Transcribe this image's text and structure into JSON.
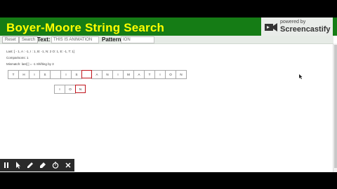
{
  "title": "Boyer-Moore String Search",
  "logo": {
    "small": "powered by",
    "big": "Screencastify"
  },
  "toolbar": {
    "reset_label": "Reset",
    "search_label": "Search",
    "text_label": "Text:",
    "text_value": "THIS IS ANIMATION",
    "pattern_label": "Pattern:",
    "pattern_value": "ION"
  },
  "info": {
    "last_line": "Last: [ - 1, A : -1, I : 1, B: -1, N: 2 O: 1, E: -1, T: 1]",
    "comparisons": "Comparisons: 1",
    "mismatch": "Mismatch: last[ ] = -1   Shifting by 3"
  },
  "text_cells": [
    "T",
    "H",
    "I",
    "S",
    "",
    "I",
    "S",
    "",
    "A",
    "N",
    "I",
    "M",
    "A",
    "T",
    "I",
    "O",
    "N"
  ],
  "highlight_text_index": 7,
  "pattern_cells": [
    "I",
    "O",
    "N"
  ],
  "highlight_pattern_index": 2,
  "colors": {
    "header": "#157c15",
    "title": "#ffff00",
    "highlight": "#c0141c"
  },
  "bottom_icons": [
    "pause-icon",
    "pointer-icon",
    "pen-icon",
    "highlighter-icon",
    "timer-icon",
    "close-icon"
  ]
}
